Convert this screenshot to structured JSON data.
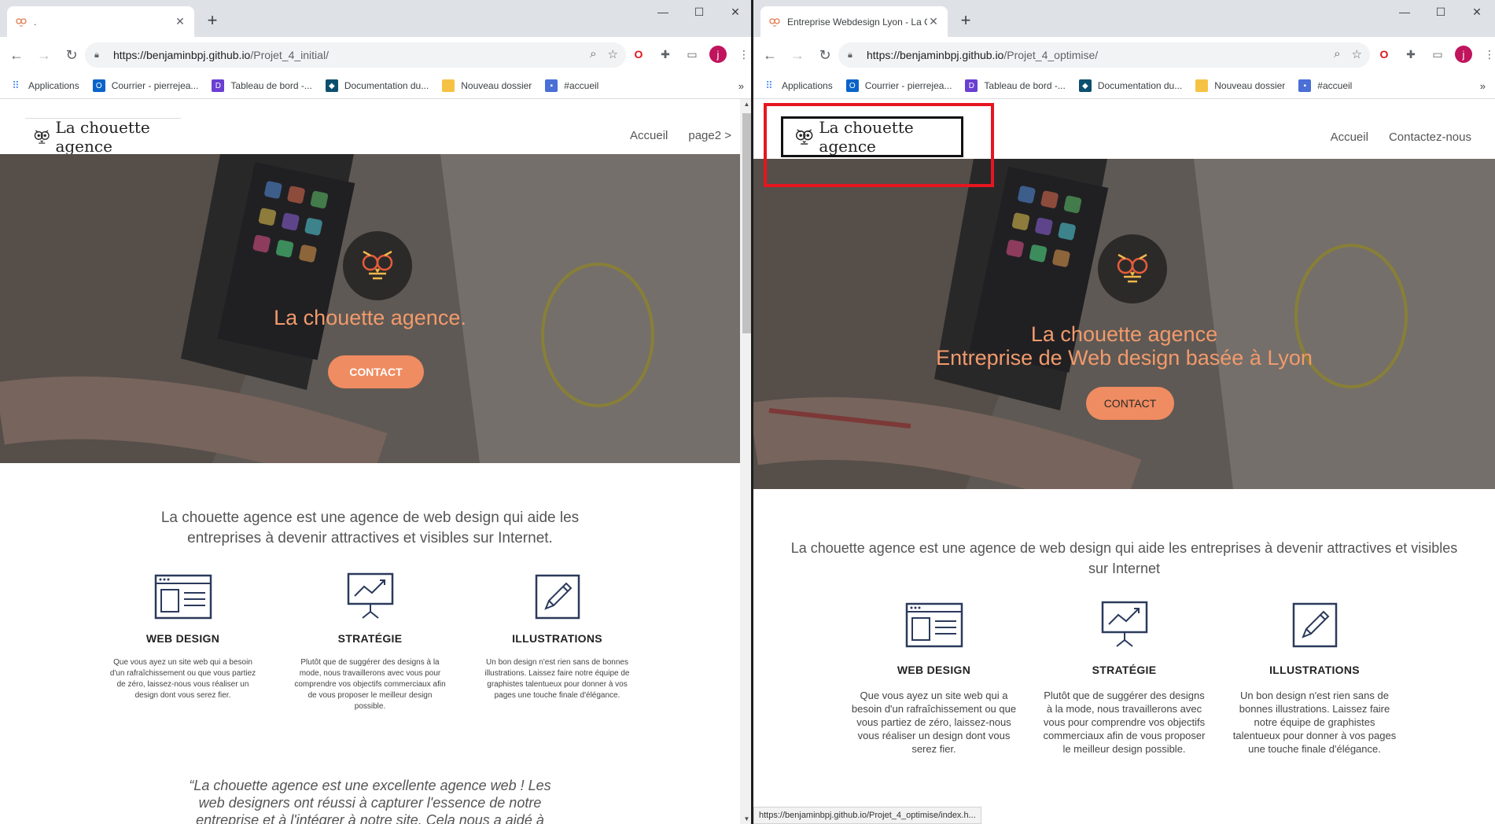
{
  "left": {
    "tab_title": ".",
    "url_host": "https://benjaminbpj.github.io",
    "url_path": "/Projet_4_initial/",
    "logo_text": "La chouette agence",
    "nav": [
      "Accueil",
      "page2 >"
    ],
    "hero_title": "La chouette agence.",
    "hero_button": "CONTACT",
    "intro": "La chouette agence est une agence de web design qui aide les entreprises à devenir attractives et visibles sur Internet.",
    "services": [
      {
        "title": "WEB DESIGN",
        "text": "Que vous ayez un site web qui a besoin d'un rafraîchissement ou que vous partiez de zéro, laissez-nous vous réaliser un design dont vous serez fier."
      },
      {
        "title": "STRATÉGIE",
        "text": "Plutôt que de suggérer des designs à la mode, nous travaillerons avec vous pour comprendre vos objectifs commerciaux afin de vous proposer le meilleur design possible."
      },
      {
        "title": "ILLUSTRATIONS",
        "text": "Un bon design n'est rien sans de bonnes illustrations. Laissez faire notre équipe de graphistes talentueux pour donner à vos pages une touche finale d'élégance."
      }
    ],
    "quote": "“La chouette agence est une excellente agence web ! Les web designers ont réussi à capturer l'essence de notre entreprise et à l'intégrer à notre site. Cela nous a aidé à"
  },
  "right": {
    "tab_title": "Entreprise Webdesign Lyon - La C",
    "url_host": "https://benjaminbpj.github.io",
    "url_path": "/Projet_4_optimise/",
    "logo_text": "La chouette agence",
    "nav": [
      "Accueil",
      "Contactez-nous"
    ],
    "hero_title_line1": "La chouette agence",
    "hero_title_line2": "Entreprise de Web design basée à Lyon",
    "hero_button": "CONTACT",
    "intro": "La chouette agence est une agence de web design qui aide les entreprises à devenir attractives et visibles sur Internet",
    "services": [
      {
        "title": "WEB DESIGN",
        "text": "Que vous ayez un site web qui a besoin d'un rafraîchissement ou que vous partiez de zéro, laissez-nous vous réaliser un design dont vous serez fier."
      },
      {
        "title": "STRATÉGIE",
        "text": "Plutôt que de suggérer des designs à la mode, nous travaillerons avec vous pour comprendre vos objectifs commerciaux afin de vous proposer le meilleur design possible."
      },
      {
        "title": "ILLUSTRATIONS",
        "text": "Un bon design n'est rien sans de bonnes illustrations. Laissez faire notre équipe de graphistes talentueux pour donner à vos pages une touche finale d'élégance."
      }
    ],
    "status_url": "https://benjaminbpj.github.io/Projet_4_optimise/index.h..."
  },
  "bookmarks": [
    {
      "label": "Applications",
      "icon": "apps-grid-icon",
      "color": "#4285f4"
    },
    {
      "label": "Courrier - pierrejea...",
      "icon": "outlook-icon",
      "color": "#0a64c8"
    },
    {
      "label": "Tableau de bord -...",
      "icon": "dashboard-icon",
      "color": "#6a3fd1"
    },
    {
      "label": "Documentation du...",
      "icon": "docs-icon",
      "color": "#0d4f6e"
    },
    {
      "label": "Nouveau dossier",
      "icon": "folder-icon",
      "color": "#f6c244"
    },
    {
      "label": "#accueil",
      "icon": "bookmark-page-icon",
      "color": "#4a6fd6"
    }
  ],
  "colors": {
    "accent": "#f08c61",
    "hero_text": "#f29a6c",
    "highlight": "#e5161f"
  },
  "avatar_letter": "j",
  "more_bookmarks": "»"
}
